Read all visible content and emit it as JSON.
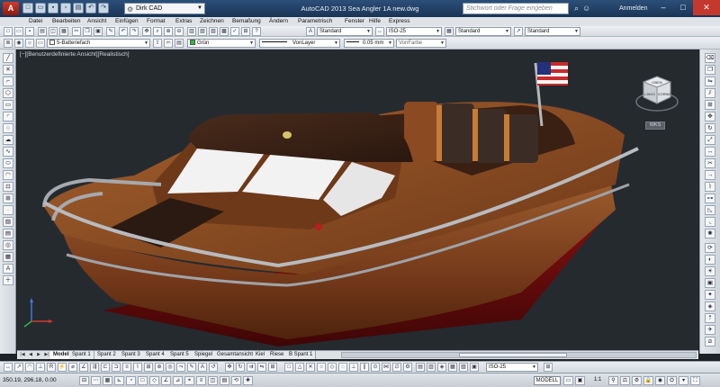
{
  "titlebar": {
    "app_logo": "A",
    "workspace": "Dirk CAD",
    "title": "AutoCAD 2013   Sea Angler 1A new.dwg",
    "help_search_placeholder": "Stichwort oder Frage eingeben",
    "login": "Anmelden"
  },
  "menubar": [
    "Datei",
    "Bearbeiten",
    "Ansicht",
    "Einfügen",
    "Format",
    "Extras",
    "Zeichnen",
    "Bemaßung",
    "Ändern",
    "Parametrisch",
    "Fenster",
    "Hilfe",
    "Express"
  ],
  "toolbar1": {
    "text_style": "Standard",
    "dim_style": "ISO-25",
    "table_style": "Standard",
    "multileader_style": "Standard"
  },
  "toolbar2": {
    "layer": "5-Batteriefach",
    "color": "Grün",
    "linetype": "VonLayer",
    "lineweight": "0.05 mm",
    "plotstyle": "VonFarbe"
  },
  "viewport": {
    "label": "[−][Benutzerdefinierte Ansicht][Realistisch]",
    "viewcube": {
      "top_face": "OBEN",
      "left_face": "LINKS",
      "right_face": "VORNE"
    },
    "wcs": "WKS"
  },
  "colors": {
    "hull": "#7a3f18",
    "hull_bottom": "#8b1010",
    "deck": "#8a4a1e",
    "roof": "#3a2216",
    "glass": "#f2f2f2",
    "seats": "#9a5a2a",
    "rail": "#a6a9ad",
    "viewport_bg": "#252a2f"
  },
  "tabs": [
    "Modell",
    "Spant 1",
    "Spant 2",
    "Spant 3",
    "Spant 4",
    "Spant 5",
    "Spiegel",
    "Gesamtansicht",
    "Kiel",
    "Riese",
    "B Spant 1"
  ],
  "bottombar": {
    "dim_style": "ISO-25"
  },
  "statusbar": {
    "coords": "350.19, 296.18, 0.00",
    "model_button": "MODELL",
    "scale": "1:1"
  }
}
